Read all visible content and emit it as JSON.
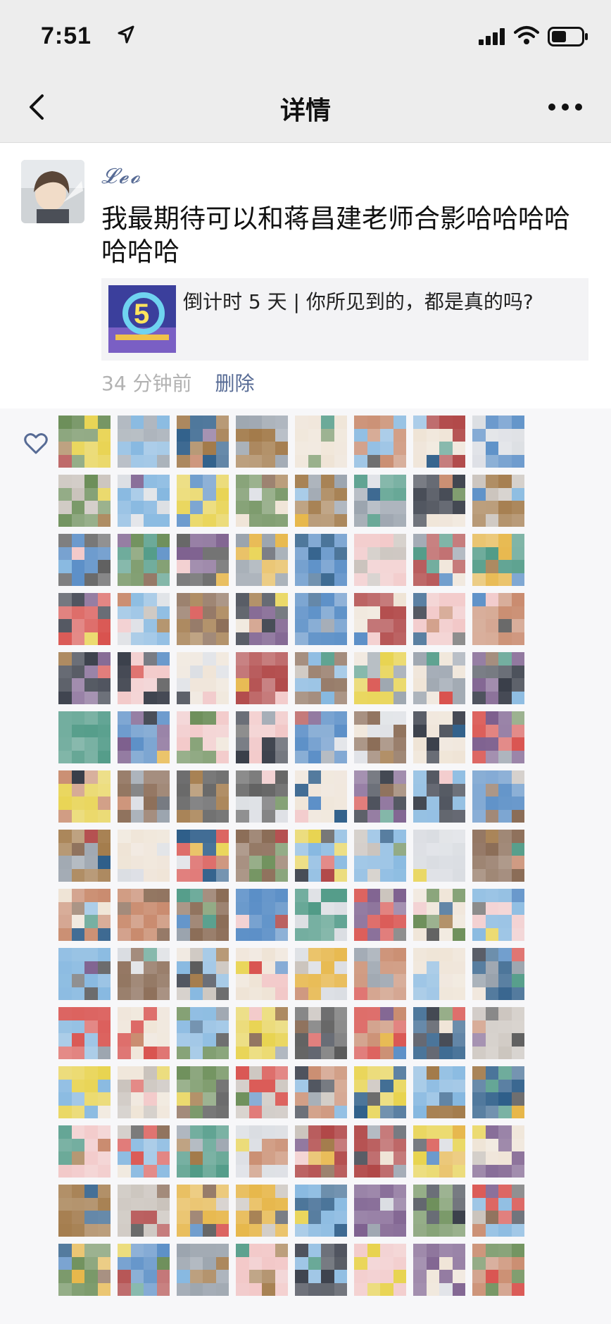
{
  "status_bar": {
    "time": "7:51",
    "location_icon": "location-arrow-icon",
    "signal_icon": "cellular-signal-icon",
    "wifi_icon": "wifi-icon",
    "battery_icon": "battery-icon"
  },
  "nav": {
    "title": "详情",
    "back_icon": "chevron-left-icon",
    "more_icon": "more-dots-icon"
  },
  "post": {
    "username": "𝓛𝓮𝓸",
    "text": "我最期待可以和蒋昌建老师合影哈哈哈哈哈哈哈",
    "link": {
      "title": "倒计时 5 天 | 你所见到的，都是真的吗?"
    },
    "timestamp": "34 分钟前",
    "delete_label": "删除"
  },
  "likes": {
    "icon": "heart-outline-icon",
    "count_shown": 120,
    "rows": 15,
    "columns": 8
  },
  "colors": {
    "background": "#ededed",
    "card": "#ffffff",
    "link_blue": "#576b95",
    "timestamp_gray": "#b2b2b2",
    "likes_background": "#f7f7f9"
  }
}
